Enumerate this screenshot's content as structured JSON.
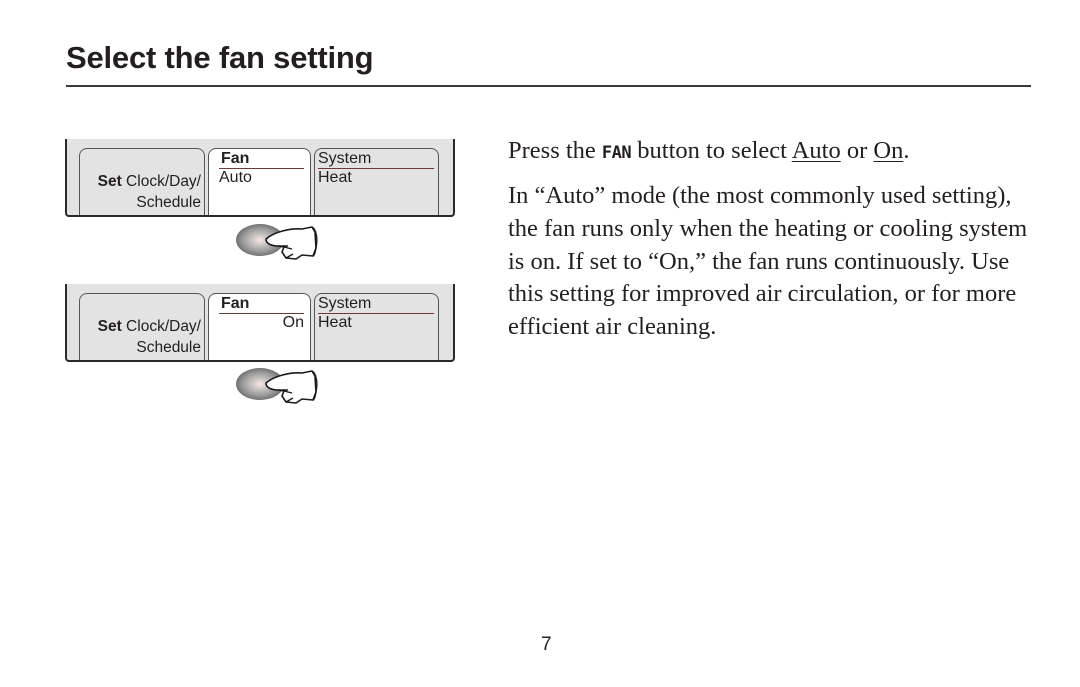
{
  "page": {
    "title": "Select the fan setting",
    "page_number": "7"
  },
  "displays": [
    {
      "set_bold": "Set",
      "set_rest": " Clock/Day/",
      "set_line2": "Schedule",
      "fan_label": "Fan",
      "fan_value": "Auto",
      "system_label": "System",
      "system_value": "Heat"
    },
    {
      "set_bold": "Set",
      "set_rest": " Clock/Day/",
      "set_line2": "Schedule",
      "fan_label": "Fan",
      "fan_value": "On",
      "system_label": "System",
      "system_value": "Heat"
    }
  ],
  "instructions": {
    "p1_prefix": "Press the ",
    "p1_key": "FAN",
    "p1_mid": " button to select ",
    "p1_option1": "Auto",
    "p1_or": " or ",
    "p1_option2": "On",
    "p1_end": ".",
    "p2": "In “Auto” mode (the most commonly used setting), the fan runs only when the heating or cooling system is on. If set to “On,” the fan runs continuously. Use this setting for improved air circulation, or for more efficient air cleaning."
  },
  "icons": {
    "press": "finger-pressing-button-icon"
  }
}
